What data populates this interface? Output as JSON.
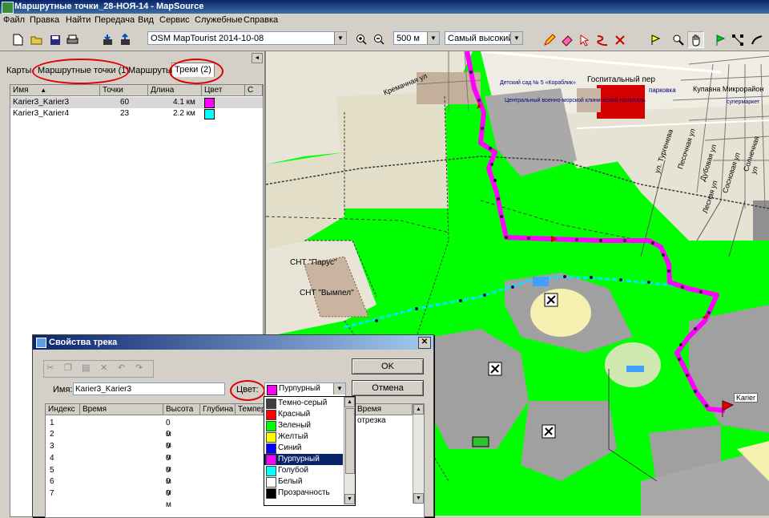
{
  "window": {
    "title": "Маршрутные точки_28-НОЯ-14 - MapSource"
  },
  "menu": [
    "Файл",
    "Правка",
    "Найти",
    "Передача",
    "Вид",
    "Сервис",
    "Служебные",
    "Справка"
  ],
  "toolbar": {
    "map_select": "OSM MapTourist 2014-10-08",
    "scale_select": "500 м",
    "detail_select": "Самый высокий"
  },
  "left_panel": {
    "tabs": [
      "Карты",
      "Маршрутные точки (1)",
      "Маршруты",
      "Треки (2)"
    ],
    "columns": [
      "Имя",
      "Точки",
      "Длина",
      "Цвет",
      "С"
    ],
    "rows": [
      {
        "name": "Karier3_Karier3",
        "points": "60",
        "length": "4.1 км",
        "color": "#ff00ff"
      },
      {
        "name": "Karier3_Karier4",
        "points": "23",
        "length": "2.2 км",
        "color": "#00ffff"
      }
    ]
  },
  "map": {
    "labels": {
      "street1": "Кремачная ул",
      "street2": "Госпитальный пер",
      "street3": "Купавна Микрорайон",
      "kindergarten": "Детский сад № 5 «Кораблик»",
      "hospital": "Центральный военно-морской клинический госпиталь",
      "parking": "парковка",
      "supermarket": "супермаркет",
      "snt_parus": "СНТ \"Парус\"",
      "snt_vympel": "СНТ \"Вымпел\"",
      "karier": "Karier",
      "st_turgeneva": "ул. Тургенева",
      "st_pesochnaya": "Песочная ул",
      "st_dubovaya": "Дубовая ул",
      "st_lesnaya": "Лесная ул",
      "st_sosnovaya": "Сосновая ул",
      "st_solnechnaya": "Солнечная ул"
    }
  },
  "dialog": {
    "title": "Свойства трека",
    "name_label": "Имя:",
    "name_value": "Karier3_Karier3",
    "color_label": "Цвет:",
    "color_value": "Пурпурный",
    "ok": "OK",
    "cancel": "Отмена",
    "columns": [
      "Индекс",
      "Время",
      "Высота",
      "Глубина",
      "Темпер",
      "Время отрезка"
    ],
    "rows": [
      {
        "index": "1",
        "alt": "0 м"
      },
      {
        "index": "2",
        "alt": "0 м"
      },
      {
        "index": "3",
        "alt": "0 м"
      },
      {
        "index": "4",
        "alt": "0 м"
      },
      {
        "index": "5",
        "alt": "0 м"
      },
      {
        "index": "6",
        "alt": "0 м"
      },
      {
        "index": "7",
        "alt": "0 м"
      }
    ],
    "color_options": [
      {
        "label": "Темно-серый",
        "color": "#404040"
      },
      {
        "label": "Красный",
        "color": "#ff0000"
      },
      {
        "label": "Зеленый",
        "color": "#00ff00"
      },
      {
        "label": "Желтый",
        "color": "#ffff00"
      },
      {
        "label": "Синий",
        "color": "#0000ff"
      },
      {
        "label": "Пурпурный",
        "color": "#ff00ff",
        "selected": true
      },
      {
        "label": "Голубой",
        "color": "#00ffff"
      },
      {
        "label": "Белый",
        "color": "#ffffff"
      },
      {
        "label": "Прозрачность",
        "color": "#000000"
      }
    ]
  },
  "colors": {
    "track_magenta": "#ff00ff",
    "track_cyan": "#00ffff",
    "forest": "#00ff00",
    "annotation_red": "#e00000"
  }
}
